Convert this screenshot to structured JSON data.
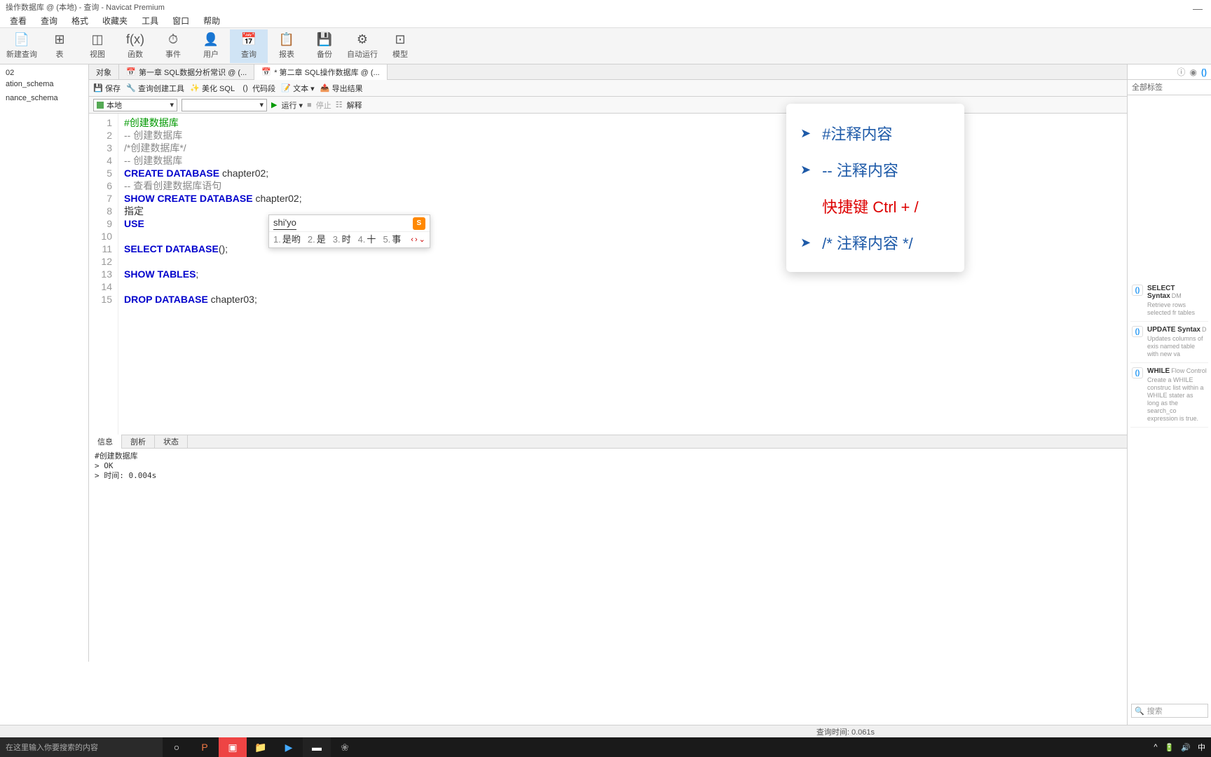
{
  "title": "操作数据库 @ (本地) - 查询 - Navicat Premium",
  "menu": [
    "查看",
    "查询",
    "格式",
    "收藏夹",
    "工具",
    "窗口",
    "帮助"
  ],
  "toolbar": [
    {
      "label": "新建查询",
      "icon": "📄"
    },
    {
      "label": "表",
      "icon": "⊞"
    },
    {
      "label": "视图",
      "icon": "◫"
    },
    {
      "label": "函数",
      "icon": "f(x)"
    },
    {
      "label": "事件",
      "icon": "⏱"
    },
    {
      "label": "用户",
      "icon": "👤"
    },
    {
      "label": "查询",
      "icon": "📅",
      "active": true
    },
    {
      "label": "报表",
      "icon": "📋"
    },
    {
      "label": "备份",
      "icon": "💾"
    },
    {
      "label": "自动运行",
      "icon": "⚙"
    },
    {
      "label": "模型",
      "icon": "⊡"
    }
  ],
  "sidebar_items": [
    "02",
    "ation_schema",
    "",
    "nance_schema"
  ],
  "tabs": [
    {
      "label": "对象"
    },
    {
      "label": "第一章 SQL数据分析常识 @ (..."
    },
    {
      "label": "* 第二章 SQL操作数据库 @ (...",
      "active": true
    }
  ],
  "editor_tools": [
    {
      "label": "保存",
      "icon": "💾"
    },
    {
      "label": "查询创建工具",
      "icon": "🔧"
    },
    {
      "label": "美化 SQL",
      "icon": "✨"
    },
    {
      "label": "代码段",
      "icon": "()"
    },
    {
      "label": "文本 ▾",
      "icon": "📝"
    },
    {
      "label": "导出结果",
      "icon": "📤"
    }
  ],
  "run_bar": {
    "combo1": "本地",
    "combo2": "",
    "run": "运行 ▾",
    "stop": "停止",
    "explain": "解释"
  },
  "code": [
    {
      "n": 1,
      "seg": [
        {
          "c": "cmt-green",
          "t": "#创建数据库"
        }
      ]
    },
    {
      "n": 2,
      "seg": [
        {
          "c": "cmt",
          "t": "-- 创建数据库"
        }
      ]
    },
    {
      "n": 3,
      "seg": [
        {
          "c": "cmt",
          "t": "/*创建数据库*/"
        }
      ]
    },
    {
      "n": 4,
      "seg": [
        {
          "c": "cmt",
          "t": "-- 创建数据库"
        }
      ]
    },
    {
      "n": 5,
      "seg": [
        {
          "c": "kw",
          "t": "CREATE DATABASE"
        },
        {
          "c": "txt",
          "t": " chapter02;"
        }
      ]
    },
    {
      "n": 6,
      "seg": [
        {
          "c": "cmt",
          "t": "-- 查看创建数据库语句"
        }
      ]
    },
    {
      "n": 7,
      "seg": [
        {
          "c": "kw",
          "t": "SHOW CREATE DATABASE"
        },
        {
          "c": "txt",
          "t": " chapter02;"
        }
      ]
    },
    {
      "n": 8,
      "seg": [
        {
          "c": "txt",
          "t": "指定"
        }
      ]
    },
    {
      "n": 9,
      "seg": [
        {
          "c": "kw",
          "t": "USE"
        },
        {
          "c": "txt",
          "t": " "
        }
      ]
    },
    {
      "n": 10,
      "seg": []
    },
    {
      "n": 11,
      "seg": [
        {
          "c": "kw",
          "t": "SELECT DATABASE"
        },
        {
          "c": "txt",
          "t": "();"
        }
      ]
    },
    {
      "n": 12,
      "seg": []
    },
    {
      "n": 13,
      "seg": [
        {
          "c": "kw",
          "t": "SHOW TABLES"
        },
        {
          "c": "txt",
          "t": ";"
        }
      ]
    },
    {
      "n": 14,
      "seg": []
    },
    {
      "n": 15,
      "seg": [
        {
          "c": "kw",
          "t": "DROP DATABASE"
        },
        {
          "c": "txt",
          "t": " chapter03;"
        }
      ]
    }
  ],
  "ime": {
    "input": "shi'yo",
    "logo": "S",
    "cands": [
      {
        "n": "1.",
        "t": "是哟"
      },
      {
        "n": "2.",
        "t": "是"
      },
      {
        "n": "3.",
        "t": "时"
      },
      {
        "n": "4.",
        "t": "十"
      },
      {
        "n": "5.",
        "t": "事"
      }
    ]
  },
  "bottom_tabs": [
    "信息",
    "剖析",
    "状态"
  ],
  "output": "#创建数据库\n> OK\n> 时间: 0.004s",
  "status": "查询时间: 0.061s",
  "right_panel": {
    "tags": "全部标签",
    "items": [
      {
        "title": "SELECT Syntax",
        "cat": "DM",
        "desc": "Retrieve rows selected fr tables"
      },
      {
        "title": "UPDATE Syntax",
        "cat": "D",
        "desc": "Updates columns of exis named table with new va"
      },
      {
        "title": "WHILE",
        "cat": "Flow Control",
        "desc": "Create a WHILE construc list within a WHILE stater as long as the search_co expression is true."
      }
    ],
    "search": "搜索"
  },
  "overlay": [
    {
      "arrow": true,
      "text": "#注释内容",
      "red": false
    },
    {
      "arrow": true,
      "text": "-- 注释内容",
      "red": false
    },
    {
      "arrow": false,
      "text": "快捷键 Ctrl + /",
      "red": true
    },
    {
      "arrow": true,
      "text": "/* 注释内容 */",
      "red": false
    }
  ],
  "taskbar": {
    "search_placeholder": "在这里输入你要搜索的内容",
    "tray": "中"
  }
}
